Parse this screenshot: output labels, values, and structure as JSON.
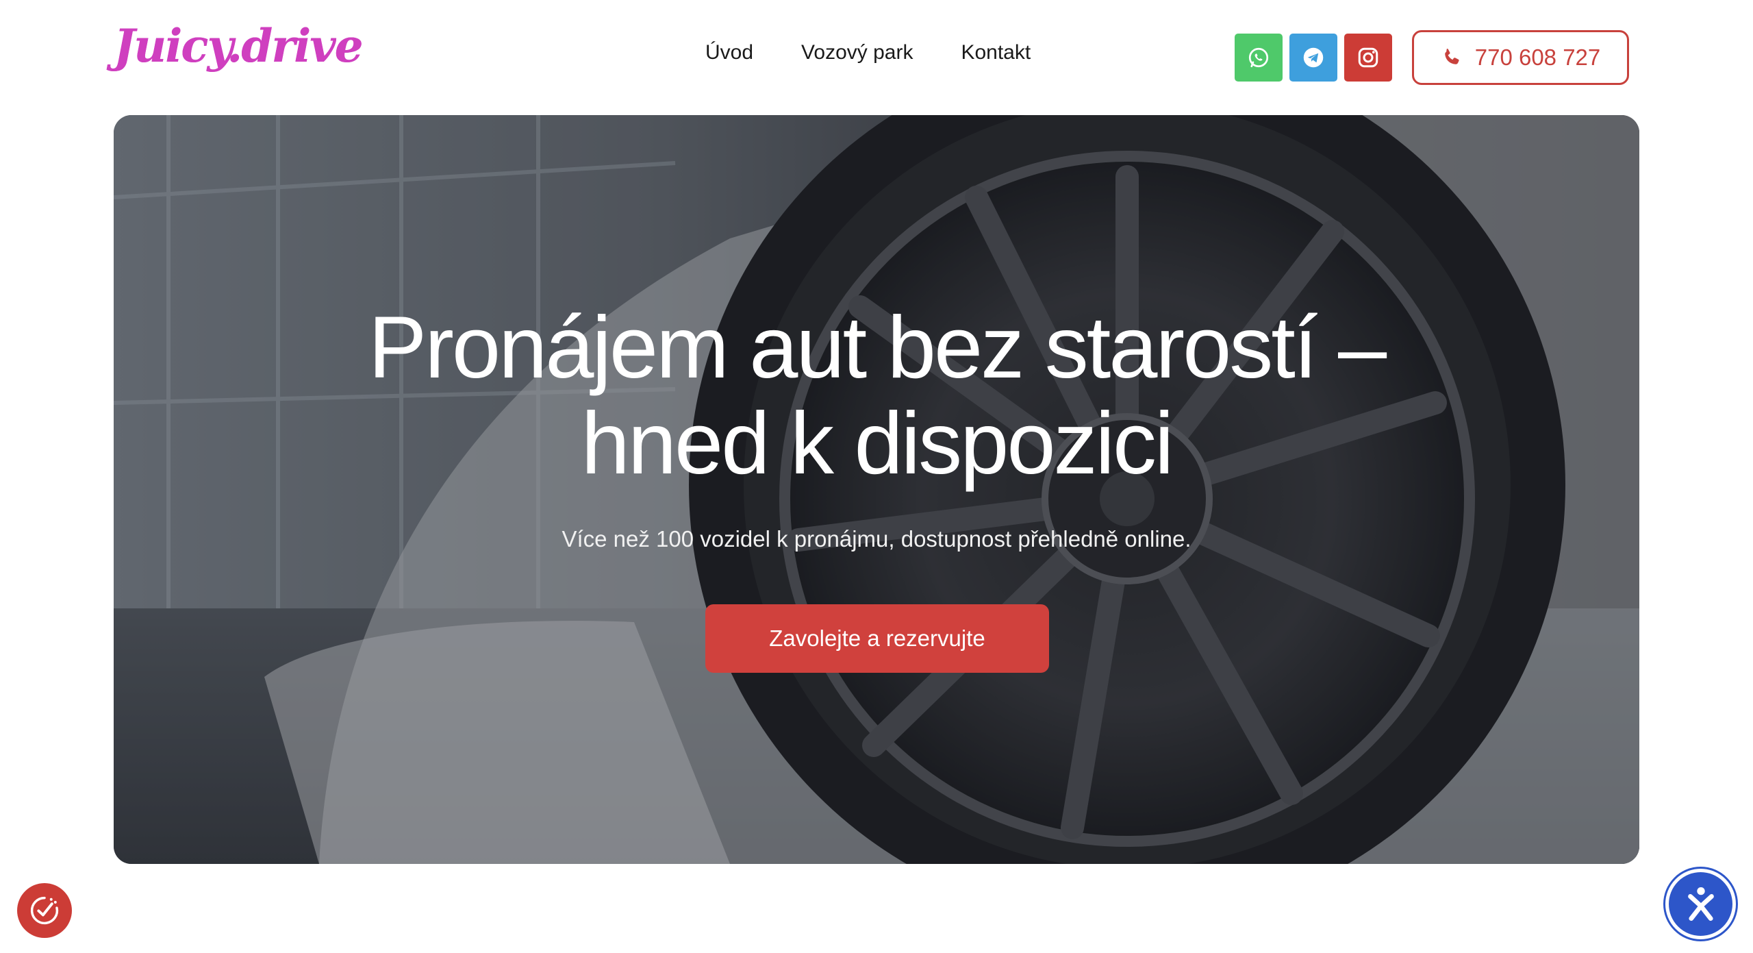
{
  "logo": {
    "text": "Juicy.drive",
    "color": "#cf3fbf"
  },
  "nav": {
    "items": [
      {
        "label": "Úvod"
      },
      {
        "label": "Vozový park"
      },
      {
        "label": "Kontakt"
      }
    ]
  },
  "social": [
    {
      "name": "whatsapp-icon",
      "color": "#4fc96a"
    },
    {
      "name": "telegram-icon",
      "color": "#3e9fdd"
    },
    {
      "name": "instagram-icon",
      "color": "#cc3c36"
    }
  ],
  "phone": {
    "label": "770 608 727",
    "icon": "phone-icon",
    "color": "#c8413c"
  },
  "hero": {
    "title_line1": "Pronájem aut bez starostí –",
    "title_line2": "hned k dispozici",
    "subtitle": "Více než 100 vozidel k pronájmu, dostupnost přehledně online.",
    "cta_label": "Zavolejte a rezervujte",
    "cta_color": "#d0413d"
  },
  "floating": {
    "cookie_icon": "cookie-consent-icon",
    "accessibility_icon": "accessibility-icon"
  }
}
